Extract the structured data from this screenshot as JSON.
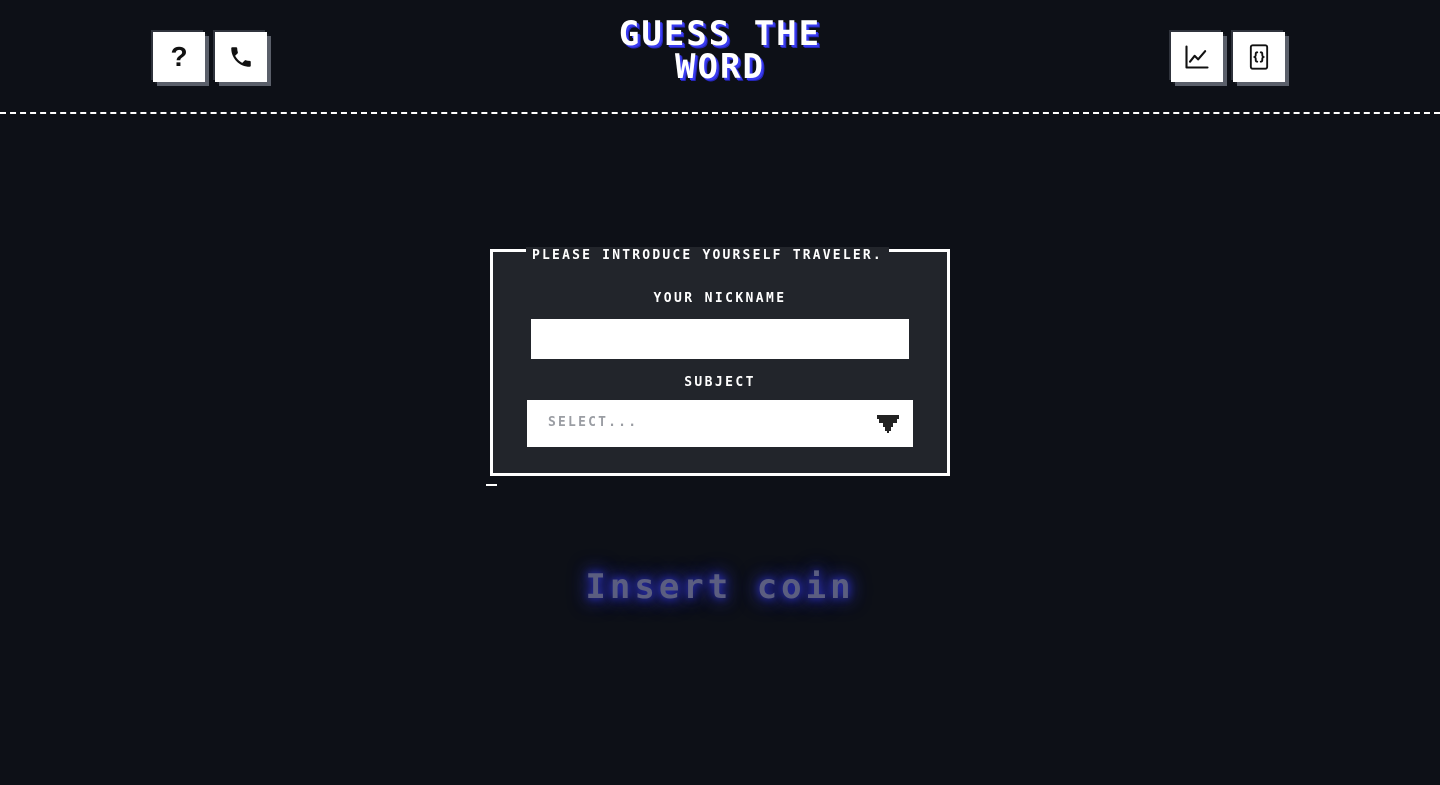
{
  "header": {
    "title": "GUESS THE\nWORD",
    "left_buttons": [
      {
        "icon": "question-mark-icon",
        "label": "?"
      },
      {
        "icon": "phone-icon"
      }
    ],
    "right_buttons": [
      {
        "icon": "line-chart-icon"
      },
      {
        "icon": "code-braces-document-icon"
      }
    ]
  },
  "form": {
    "legend": "PLEASE INTRODUCE YOURSELF TRAVELER.",
    "nickname_label": "YOUR NICKNAME",
    "nickname_value": "",
    "subject_label": "SUBJECT",
    "subject_placeholder": "SELECT...",
    "subject_arrow_icon": "pixel-down-arrow-icon"
  },
  "footer_prompt": "Insert coin",
  "colors": {
    "background": "#0d1017",
    "panel": "#22252b",
    "title_shadow": "#3a3cf0",
    "insert_coin": "#5b5e80"
  }
}
